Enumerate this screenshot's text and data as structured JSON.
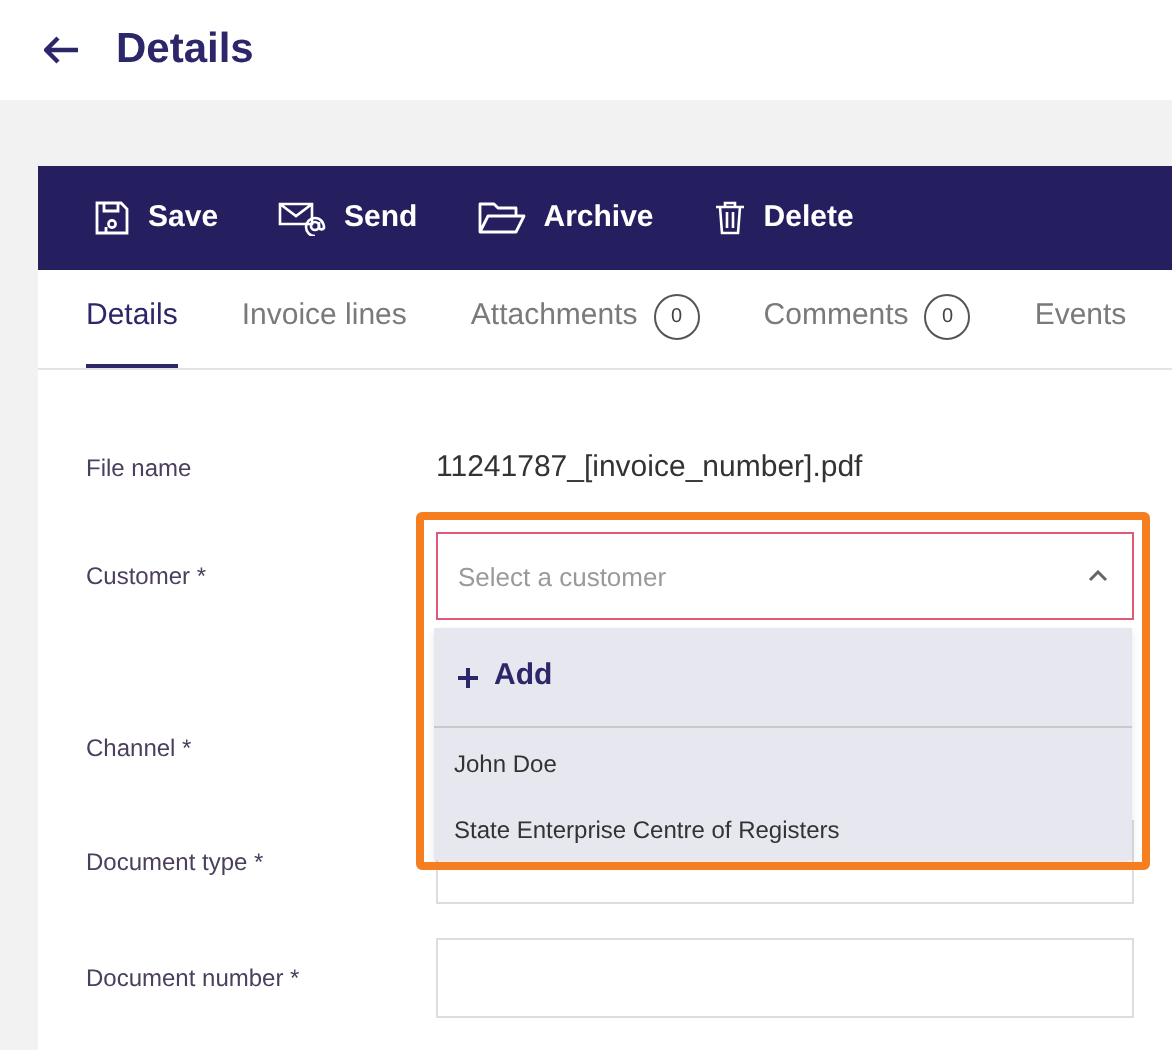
{
  "header": {
    "title": "Details"
  },
  "toolbar": [
    {
      "kind": "save",
      "label": "Save"
    },
    {
      "kind": "send",
      "label": "Send"
    },
    {
      "kind": "archive",
      "label": "Archive"
    },
    {
      "kind": "delete",
      "label": "Delete"
    }
  ],
  "tabs": [
    {
      "label": "Details",
      "selected": true
    },
    {
      "label": "Invoice lines",
      "selected": false
    },
    {
      "label": "Attachments",
      "selected": false,
      "count": "0"
    },
    {
      "label": "Comments",
      "selected": false,
      "count": "0"
    },
    {
      "label": "Events",
      "selected": false
    }
  ],
  "form": {
    "file_name": {
      "label": "File name",
      "value": "11241787_[invoice_number].pdf"
    },
    "customer": {
      "label": "Customer *",
      "placeholder": "Select a customer",
      "expanded": true,
      "highlighted": true,
      "dropdown": {
        "add_label": "Add",
        "options": [
          "John Doe",
          "State Enterprise Centre of Registers"
        ]
      }
    },
    "channel": {
      "label": "Channel *"
    },
    "document_type": {
      "label": "Document type *"
    },
    "document_number": {
      "label": "Document number *"
    }
  }
}
